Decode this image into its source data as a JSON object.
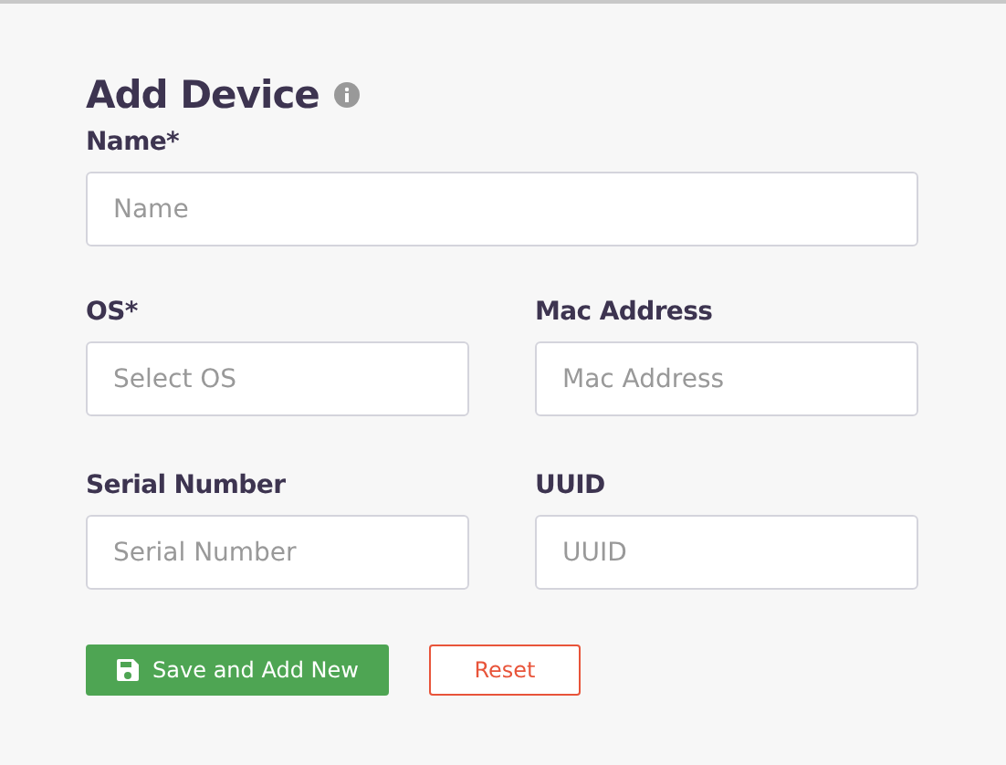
{
  "title": "Add Device",
  "fields": [
    {
      "label": "Name*",
      "placeholder": "Name",
      "kind": "wide"
    },
    {
      "label": "OS*",
      "placeholder": "Select OS",
      "kind": "half"
    },
    {
      "label": "Mac Address",
      "placeholder": "Mac Address",
      "kind": "half"
    },
    {
      "label": "Serial Number",
      "placeholder": "Serial Number",
      "kind": "half"
    },
    {
      "label": "UUID",
      "placeholder": "UUID",
      "kind": "half"
    }
  ],
  "buttons": [
    {
      "label": "Save and Add New",
      "kind": "primary"
    },
    {
      "label": "Reset",
      "kind": "outline"
    }
  ]
}
